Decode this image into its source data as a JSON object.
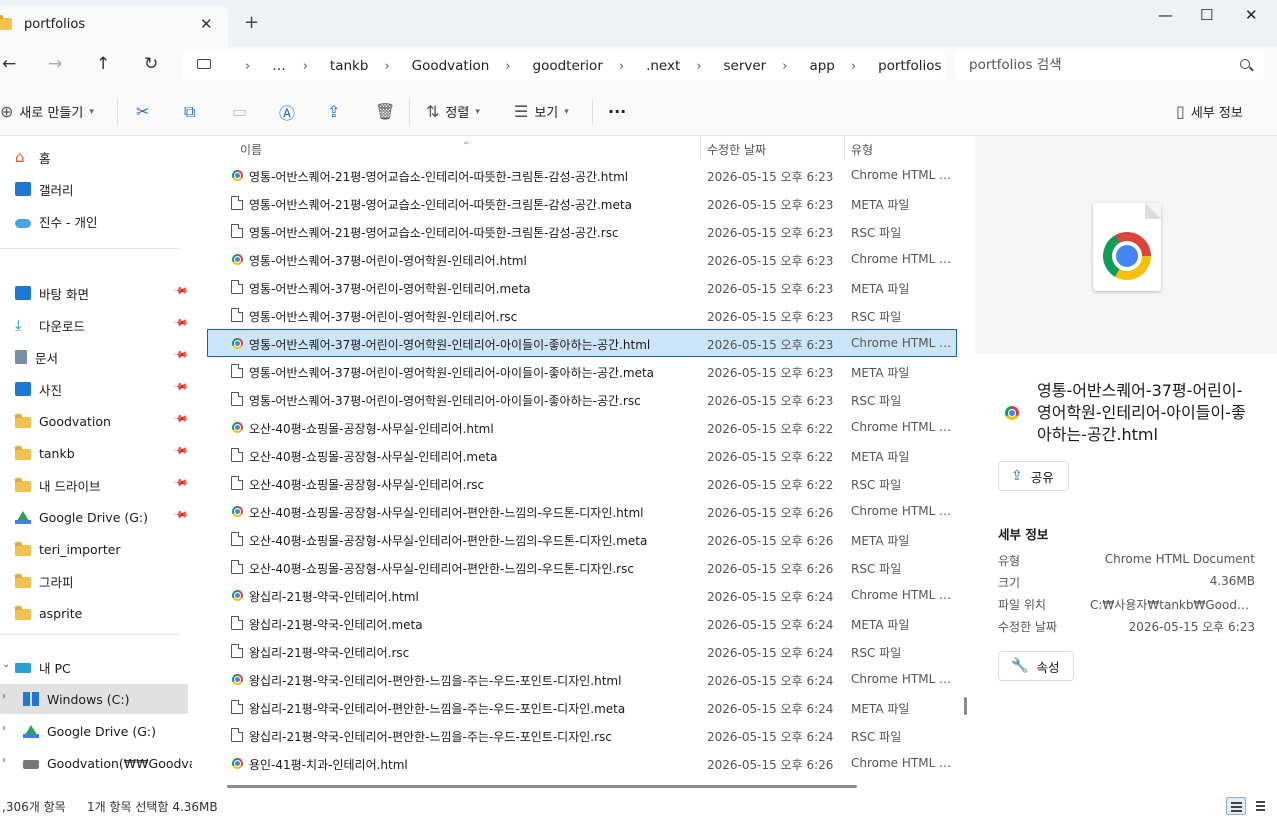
{
  "window": {
    "tab_title": "portfolios",
    "tab_close": "✕",
    "new_tab": "+",
    "minimize": "—",
    "maximize": "☐",
    "close": "✕"
  },
  "nav": {
    "back": "←",
    "forward": "→",
    "up": "↑",
    "refresh": "↻"
  },
  "breadcrumbs": [
    "…",
    "tankb",
    "Goodvation",
    "goodterior",
    ".next",
    "server",
    "app",
    "portfolios"
  ],
  "search": {
    "placeholder": "portfolios 검색"
  },
  "toolbar": {
    "new_label": "새로 만들기",
    "sort_label": "정렬",
    "view_label": "보기",
    "more_label": "···",
    "details_label": "세부 정보"
  },
  "sidebar": {
    "quick": [
      {
        "label": "홈",
        "icon": "home-icon"
      },
      {
        "label": "갤러리",
        "icon": "gallery-icon"
      },
      {
        "label": "진수 - 개인",
        "icon": "onedrive-icon"
      }
    ],
    "pinned": [
      {
        "label": "바탕 화면",
        "icon": "desktop-icon",
        "pinned": true
      },
      {
        "label": "다운로드",
        "icon": "download-icon",
        "pinned": true
      },
      {
        "label": "문서",
        "icon": "document-icon",
        "pinned": true
      },
      {
        "label": "사진",
        "icon": "picture-icon",
        "pinned": true
      },
      {
        "label": "Goodvation",
        "icon": "folder-icon",
        "pinned": true
      },
      {
        "label": "tankb",
        "icon": "folder-icon",
        "pinned": true
      },
      {
        "label": "내 드라이브",
        "icon": "folder-icon",
        "pinned": true
      },
      {
        "label": "Google Drive (G:)",
        "icon": "google-drive-icon",
        "pinned": true
      },
      {
        "label": "teri_importer",
        "icon": "folder-icon",
        "pinned": false
      },
      {
        "label": "그라피",
        "icon": "folder-icon",
        "pinned": false
      },
      {
        "label": "asprite",
        "icon": "folder-icon",
        "pinned": false
      }
    ],
    "pc": [
      {
        "label": "내 PC",
        "icon": "pc-icon",
        "expandable": true
      },
      {
        "label": "Windows (C:)",
        "icon": "windows-drive-icon",
        "expandable": true,
        "selected": true
      },
      {
        "label": "Google Drive (G:)",
        "icon": "google-drive-icon",
        "expandable": true
      },
      {
        "label": "Goodvation(₩₩Goodvation",
        "icon": "network-drive-icon",
        "expandable": true
      }
    ]
  },
  "columns": {
    "name": "이름",
    "date": "수정한 날짜",
    "type": "유형"
  },
  "files": [
    {
      "name": "영통-어반스퀘어-21평-영어교습소-인테리어-따뜻한-크림톤-감성-공간.html",
      "date": "2026-05-15 오후 6:23",
      "type": "Chrome HTML D...",
      "icon": "chrome"
    },
    {
      "name": "영통-어반스퀘어-21평-영어교습소-인테리어-따뜻한-크림톤-감성-공간.meta",
      "date": "2026-05-15 오후 6:23",
      "type": "META 파일",
      "icon": "file"
    },
    {
      "name": "영통-어반스퀘어-21평-영어교습소-인테리어-따뜻한-크림톤-감성-공간.rsc",
      "date": "2026-05-15 오후 6:23",
      "type": "RSC 파일",
      "icon": "file"
    },
    {
      "name": "영통-어반스퀘어-37평-어린이-영어학원-인테리어.html",
      "date": "2026-05-15 오후 6:23",
      "type": "Chrome HTML D...",
      "icon": "chrome"
    },
    {
      "name": "영통-어반스퀘어-37평-어린이-영어학원-인테리어.meta",
      "date": "2026-05-15 오후 6:23",
      "type": "META 파일",
      "icon": "file"
    },
    {
      "name": "영통-어반스퀘어-37평-어린이-영어학원-인테리어.rsc",
      "date": "2026-05-15 오후 6:23",
      "type": "RSC 파일",
      "icon": "file"
    },
    {
      "name": "영통-어반스퀘어-37평-어린이-영어학원-인테리어-아이들이-좋아하는-공간.html",
      "date": "2026-05-15 오후 6:23",
      "type": "Chrome HTML D...",
      "icon": "chrome",
      "selected": true
    },
    {
      "name": "영통-어반스퀘어-37평-어린이-영어학원-인테리어-아이들이-좋아하는-공간.meta",
      "date": "2026-05-15 오후 6:23",
      "type": "META 파일",
      "icon": "file"
    },
    {
      "name": "영통-어반스퀘어-37평-어린이-영어학원-인테리어-아이들이-좋아하는-공간.rsc",
      "date": "2026-05-15 오후 6:23",
      "type": "RSC 파일",
      "icon": "file"
    },
    {
      "name": "오산-40평-쇼핑몰-공장형-사무실-인테리어.html",
      "date": "2026-05-15 오후 6:22",
      "type": "Chrome HTML D...",
      "icon": "chrome"
    },
    {
      "name": "오산-40평-쇼핑몰-공장형-사무실-인테리어.meta",
      "date": "2026-05-15 오후 6:22",
      "type": "META 파일",
      "icon": "file"
    },
    {
      "name": "오산-40평-쇼핑몰-공장형-사무실-인테리어.rsc",
      "date": "2026-05-15 오후 6:22",
      "type": "RSC 파일",
      "icon": "file"
    },
    {
      "name": "오산-40평-쇼핑몰-공장형-사무실-인테리어-편안한-느낌의-우드톤-디자인.html",
      "date": "2026-05-15 오후 6:26",
      "type": "Chrome HTML D...",
      "icon": "chrome"
    },
    {
      "name": "오산-40평-쇼핑몰-공장형-사무실-인테리어-편안한-느낌의-우드톤-디자인.meta",
      "date": "2026-05-15 오후 6:26",
      "type": "META 파일",
      "icon": "file"
    },
    {
      "name": "오산-40평-쇼핑몰-공장형-사무실-인테리어-편안한-느낌의-우드톤-디자인.rsc",
      "date": "2026-05-15 오후 6:26",
      "type": "RSC 파일",
      "icon": "file"
    },
    {
      "name": "왕십리-21평-약국-인테리어.html",
      "date": "2026-05-15 오후 6:24",
      "type": "Chrome HTML D...",
      "icon": "chrome"
    },
    {
      "name": "왕십리-21평-약국-인테리어.meta",
      "date": "2026-05-15 오후 6:24",
      "type": "META 파일",
      "icon": "file"
    },
    {
      "name": "왕십리-21평-약국-인테리어.rsc",
      "date": "2026-05-15 오후 6:24",
      "type": "RSC 파일",
      "icon": "file"
    },
    {
      "name": "왕십리-21평-약국-인테리어-편안한-느낌을-주는-우드-포인트-디자인.html",
      "date": "2026-05-15 오후 6:24",
      "type": "Chrome HTML D...",
      "icon": "chrome"
    },
    {
      "name": "왕십리-21평-약국-인테리어-편안한-느낌을-주는-우드-포인트-디자인.meta",
      "date": "2026-05-15 오후 6:24",
      "type": "META 파일",
      "icon": "file"
    },
    {
      "name": "왕십리-21평-약국-인테리어-편안한-느낌을-주는-우드-포인트-디자인.rsc",
      "date": "2026-05-15 오후 6:24",
      "type": "RSC 파일",
      "icon": "file"
    },
    {
      "name": "용인-41평-치과-인테리어.html",
      "date": "2026-05-15 오후 6:26",
      "type": "Chrome HTML D...",
      "icon": "chrome"
    }
  ],
  "details": {
    "file_title": "영통-어반스퀘어-37평-어린이-영어학원-인테리어-아이들이-좋아하는-공간.html",
    "share_label": "공유",
    "section_label": "세부 정보",
    "props": [
      {
        "key": "유형",
        "value": "Chrome HTML Document"
      },
      {
        "key": "크기",
        "value": "4.36MB"
      },
      {
        "key": "파일 위치",
        "value": "C:₩사용자₩tankb₩Goodvation₩goodterior₩.next"
      },
      {
        "key": "수정한 날짜",
        "value": "2026-05-15 오후 6:23"
      }
    ],
    "properties_label": "속성"
  },
  "status": {
    "count": ",306개 항목",
    "selection": "1개 항목 선택함 4.36MB"
  },
  "colors": {
    "selection": "#cce4f7",
    "accent": "#1a5fb4",
    "folder": "#f2c14e"
  }
}
